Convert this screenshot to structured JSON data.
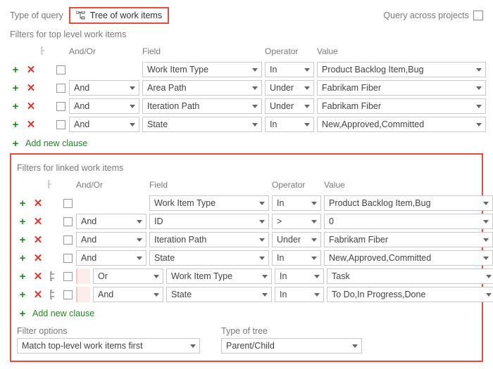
{
  "top": {
    "type_of_query_label": "Type of query",
    "type_of_query_value": "Tree of work items",
    "query_across_projects_label": "Query across projects"
  },
  "section1": {
    "title": "Filters for top level work items",
    "headers": {
      "andor": "And/Or",
      "field": "Field",
      "operator": "Operator",
      "value": "Value"
    },
    "rows": [
      {
        "andor": "",
        "field": "Work Item Type",
        "operator": "In",
        "value": "Product Backlog Item,Bug"
      },
      {
        "andor": "And",
        "field": "Area Path",
        "operator": "Under",
        "value": "Fabrikam Fiber"
      },
      {
        "andor": "And",
        "field": "Iteration Path",
        "operator": "Under",
        "value": "Fabrikam Fiber"
      },
      {
        "andor": "And",
        "field": "State",
        "operator": "In",
        "value": "New,Approved,Committed"
      }
    ],
    "add_label": "Add new clause"
  },
  "section2": {
    "title": "Filters for linked work items",
    "headers": {
      "andor": "And/Or",
      "field": "Field",
      "operator": "Operator",
      "value": "Value"
    },
    "rows": [
      {
        "indent": false,
        "andor": "",
        "field": "Work Item Type",
        "operator": "In",
        "value": "Product Backlog Item,Bug"
      },
      {
        "indent": false,
        "andor": "And",
        "field": "ID",
        "operator": ">",
        "value": "0"
      },
      {
        "indent": false,
        "andor": "And",
        "field": "Iteration Path",
        "operator": "Under",
        "value": "Fabrikam Fiber"
      },
      {
        "indent": false,
        "andor": "And",
        "field": "State",
        "operator": "In",
        "value": "New,Approved,Committed"
      },
      {
        "indent": true,
        "andor": "Or",
        "field": "Work Item Type",
        "operator": "In",
        "value": "Task"
      },
      {
        "indent": true,
        "andor": "And",
        "field": "State",
        "operator": "In",
        "value": "To Do,In Progress,Done"
      }
    ],
    "add_label": "Add new clause",
    "filter_options_label": "Filter options",
    "filter_options_value": "Match top-level work items first",
    "type_of_tree_label": "Type of tree",
    "type_of_tree_value": "Parent/Child"
  }
}
